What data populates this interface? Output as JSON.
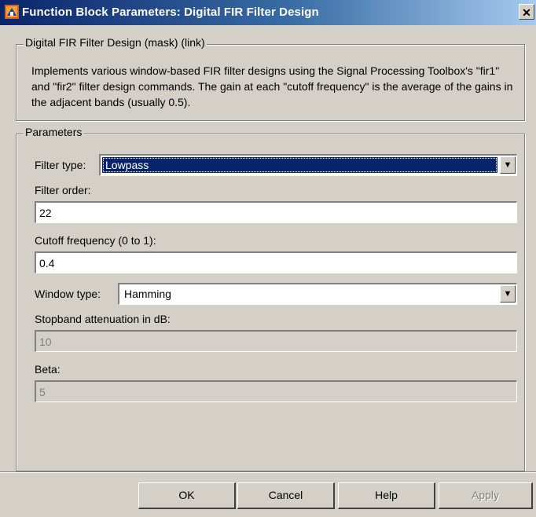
{
  "window": {
    "title": "Function Block Parameters: Digital FIR Filter Design",
    "close_glyph": "✕",
    "icon": "simulink-block-icon"
  },
  "mask": {
    "group_title": "Digital FIR Filter Design (mask) (link)",
    "description": "Implements various window-based FIR filter designs using the Signal Processing Toolbox's \"fir1\" and \"fir2\" filter design commands.  The gain at each \"cutoff frequency\" is the average of the gains in the adjacent bands (usually 0.5)."
  },
  "parameters": {
    "group_title": "Parameters",
    "filter_type": {
      "label": "Filter type:",
      "value": "Lowpass"
    },
    "filter_order": {
      "label": "Filter order:",
      "value": "22"
    },
    "cutoff_frequency": {
      "label": "Cutoff frequency (0 to 1):",
      "value": "0.4"
    },
    "window_type": {
      "label": "Window type:",
      "value": "Hamming"
    },
    "stopband_attenuation": {
      "label": "Stopband attenuation in dB:",
      "value": "10"
    },
    "beta": {
      "label": "Beta:",
      "value": "5"
    }
  },
  "buttons": {
    "ok": "OK",
    "cancel": "Cancel",
    "help": "Help",
    "apply": "Apply"
  },
  "colors": {
    "title_bar": "#0a246a",
    "dialog_face": "#d4d0c8",
    "selection": "#0a246a"
  }
}
